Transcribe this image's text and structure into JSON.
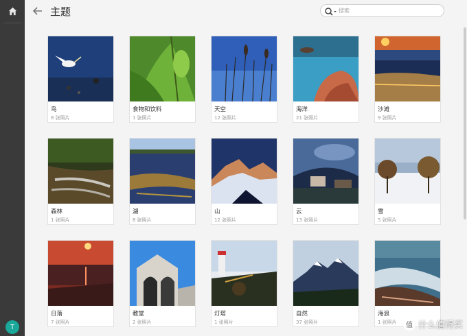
{
  "sidebar": {
    "home_icon": "home-icon",
    "avatar_letter": "T",
    "avatar_color": "#1aa89a"
  },
  "header": {
    "back_icon": "back-arrow-icon",
    "title": "主题"
  },
  "search": {
    "icon": "search-icon",
    "placeholder": "搜索",
    "value": ""
  },
  "topics": [
    {
      "label": "鸟",
      "count": "8 张照片",
      "palette": "bird"
    },
    {
      "label": "食物和饮料",
      "count": "1 张照片",
      "palette": "food"
    },
    {
      "label": "天空",
      "count": "12 张照片",
      "palette": "sky"
    },
    {
      "label": "海洋",
      "count": "21 张照片",
      "palette": "ocean"
    },
    {
      "label": "沙滩",
      "count": "9 张照片",
      "palette": "beach"
    },
    {
      "label": "森林",
      "count": "1 张照片",
      "palette": "forest"
    },
    {
      "label": "湖",
      "count": "8 张照片",
      "palette": "lake"
    },
    {
      "label": "山",
      "count": "12 张照片",
      "palette": "mountain"
    },
    {
      "label": "云",
      "count": "13 张照片",
      "palette": "cloud"
    },
    {
      "label": "雪",
      "count": "5 张照片",
      "palette": "snow"
    },
    {
      "label": "日落",
      "count": "7 张照片",
      "palette": "sunset"
    },
    {
      "label": "教堂",
      "count": "2 张照片",
      "palette": "church"
    },
    {
      "label": "灯塔",
      "count": "1 张照片",
      "palette": "lighthouse"
    },
    {
      "label": "自然",
      "count": "37 张照片",
      "palette": "nature"
    },
    {
      "label": "海浪",
      "count": "1 张照片",
      "palette": "waves"
    }
  ],
  "watermark": {
    "logo_char": "值",
    "text": "什么值得买"
  }
}
